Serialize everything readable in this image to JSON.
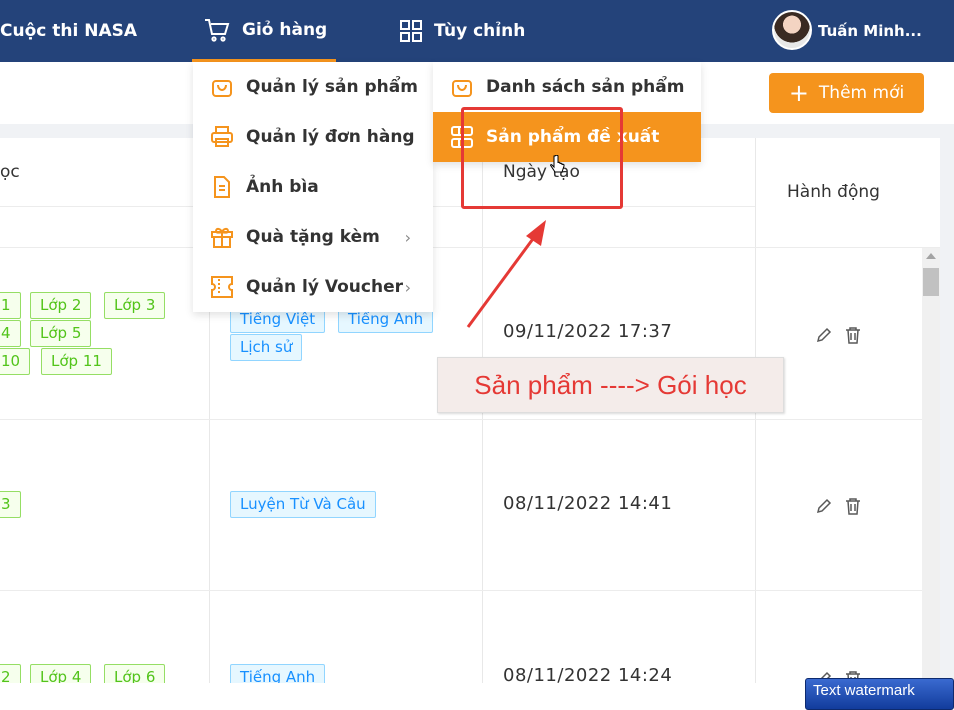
{
  "nav": {
    "contest": "Cuộc thi NASA",
    "cart": "Giỏ hàng",
    "customize": "Tùy chỉnh",
    "user_name": "Tuấn Minh..."
  },
  "toolbar": {
    "add_label": "Thêm mới",
    "add_icon": "+"
  },
  "table": {
    "headers": {
      "course": "ọc",
      "created": "Ngày tạo",
      "actions": "Hành động"
    },
    "rows": [
      {
        "grades": [
          "1",
          "Lớp 2",
          "Lớp 3",
          "4",
          "Lớp 5",
          "10",
          "Lớp 11"
        ],
        "subjects": [
          "Tiếng Việt",
          "Tiếng Anh",
          "Lịch sử"
        ],
        "date": "09/11/2022 17:37"
      },
      {
        "grades": [
          "3"
        ],
        "subjects": [
          "Luyện Từ Và Câu"
        ],
        "date": "08/11/2022 14:41"
      },
      {
        "grades": [
          "2",
          "Lớp 4",
          "Lớp 6"
        ],
        "subjects": [
          "Tiếng Anh"
        ],
        "date": "08/11/2022 14:24"
      }
    ]
  },
  "menu": {
    "items": [
      {
        "label": "Quản lý sản phẩm",
        "icon": "bag-icon"
      },
      {
        "label": "Quản lý đơn hàng",
        "icon": "printer-icon"
      },
      {
        "label": "Ảnh bìa",
        "icon": "file-icon"
      },
      {
        "label": "Quà tặng kèm",
        "icon": "gift-icon",
        "chevron": "›"
      },
      {
        "label": "Quản lý Voucher",
        "icon": "ticket-icon",
        "chevron": "›"
      }
    ],
    "submenu": [
      {
        "label": "Danh sách sản phẩm",
        "icon": "bag-icon"
      },
      {
        "label": "Sản phẩm đề xuất",
        "icon": "layout-icon",
        "active": true
      }
    ]
  },
  "annotation": {
    "text": "Sản phẩm ----> Gói học"
  },
  "watermark": "Text watermark",
  "colors": {
    "nav": "#24437a",
    "accent": "#f5941d",
    "annotation": "#e53935"
  }
}
